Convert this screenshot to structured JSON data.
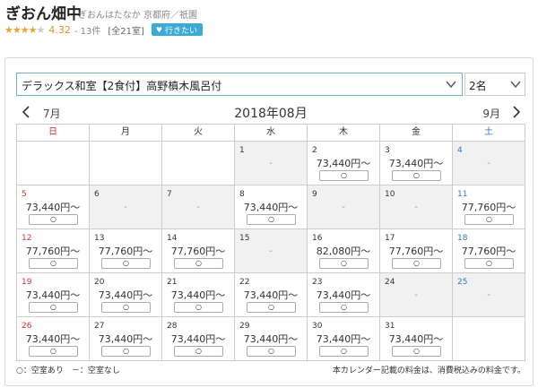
{
  "hotel": {
    "name": "ぎおん畑中",
    "reading": "ぎおんはたなか",
    "location": "京都府／祇園",
    "rating_stars": "★★★★★",
    "score": "4.32",
    "review_count": "- 13件",
    "room_count": "[全21室]",
    "want_button": "行きたい"
  },
  "filters": {
    "room_plan": "デラックス和室【2食付】高野槙木風呂付",
    "guests": "2名"
  },
  "calendar": {
    "prev_month": "7月",
    "current_month": "2018年08月",
    "next_month": "9月",
    "weekdays": [
      "日",
      "月",
      "火",
      "水",
      "木",
      "金",
      "土"
    ],
    "weeks": [
      [
        {
          "day": "",
          "price": "",
          "available": "",
          "type": "empty"
        },
        {
          "day": "",
          "price": "",
          "available": "",
          "type": "empty"
        },
        {
          "day": "",
          "price": "",
          "available": "",
          "type": "empty"
        },
        {
          "day": "1",
          "price": "",
          "available": "-",
          "type": "na"
        },
        {
          "day": "2",
          "price": "73,440円～",
          "available": "○",
          "type": "ok"
        },
        {
          "day": "3",
          "price": "73,440円～",
          "available": "○",
          "type": "ok"
        },
        {
          "day": "4",
          "price": "",
          "available": "-",
          "type": "na"
        }
      ],
      [
        {
          "day": "5",
          "price": "73,440円～",
          "available": "○",
          "type": "ok"
        },
        {
          "day": "6",
          "price": "",
          "available": "-",
          "type": "na"
        },
        {
          "day": "7",
          "price": "",
          "available": "-",
          "type": "na"
        },
        {
          "day": "8",
          "price": "73,440円～",
          "available": "○",
          "type": "ok"
        },
        {
          "day": "9",
          "price": "",
          "available": "-",
          "type": "na"
        },
        {
          "day": "10",
          "price": "",
          "available": "-",
          "type": "na"
        },
        {
          "day": "11",
          "price": "77,760円～",
          "available": "○",
          "type": "ok"
        }
      ],
      [
        {
          "day": "12",
          "price": "77,760円～",
          "available": "○",
          "type": "ok"
        },
        {
          "day": "13",
          "price": "77,760円～",
          "available": "○",
          "type": "ok"
        },
        {
          "day": "14",
          "price": "77,760円～",
          "available": "○",
          "type": "ok"
        },
        {
          "day": "15",
          "price": "",
          "available": "-",
          "type": "na"
        },
        {
          "day": "16",
          "price": "82,080円～",
          "available": "○",
          "type": "ok"
        },
        {
          "day": "17",
          "price": "77,760円～",
          "available": "○",
          "type": "ok"
        },
        {
          "day": "18",
          "price": "77,760円～",
          "available": "○",
          "type": "ok"
        }
      ],
      [
        {
          "day": "19",
          "price": "73,440円～",
          "available": "○",
          "type": "ok"
        },
        {
          "day": "20",
          "price": "73,440円～",
          "available": "○",
          "type": "ok"
        },
        {
          "day": "21",
          "price": "73,440円～",
          "available": "○",
          "type": "ok"
        },
        {
          "day": "22",
          "price": "73,440円～",
          "available": "○",
          "type": "ok"
        },
        {
          "day": "23",
          "price": "73,440円～",
          "available": "○",
          "type": "ok"
        },
        {
          "day": "24",
          "price": "",
          "available": "-",
          "type": "na"
        },
        {
          "day": "25",
          "price": "",
          "available": "-",
          "type": "na"
        }
      ],
      [
        {
          "day": "26",
          "price": "73,440円～",
          "available": "○",
          "type": "ok"
        },
        {
          "day": "27",
          "price": "73,440円～",
          "available": "○",
          "type": "ok"
        },
        {
          "day": "28",
          "price": "73,440円～",
          "available": "○",
          "type": "ok"
        },
        {
          "day": "29",
          "price": "73,440円～",
          "available": "○",
          "type": "ok"
        },
        {
          "day": "30",
          "price": "73,440円～",
          "available": "○",
          "type": "ok"
        },
        {
          "day": "31",
          "price": "73,440円～",
          "available": "○",
          "type": "ok"
        },
        {
          "day": "",
          "price": "",
          "available": "",
          "type": "empty"
        }
      ]
    ]
  },
  "footer": {
    "legend": "○：空室あり　－：空室なし",
    "note": "本カレンダー記載の料金は、消費税込みの料金です。"
  },
  "colors": {
    "accent": "#3aabd6",
    "star": "#f0a030",
    "sunday": "#d63030",
    "saturday": "#3377cc",
    "unavailable_bg": "#f1f1f1"
  }
}
